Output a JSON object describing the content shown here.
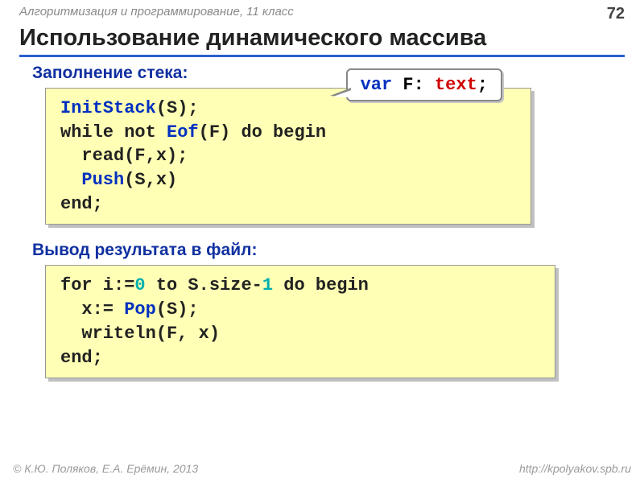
{
  "header": {
    "course": "Алгоритмизация и программирование, 11 класс",
    "page": "72"
  },
  "title": "Использование динамического массива",
  "section1_title": "Заполнение стека:",
  "callout": {
    "kw_var": "var",
    "var_name": " F",
    "colon": ": ",
    "type": "text",
    "semi": ";"
  },
  "code1": {
    "l1_fn": "InitStack",
    "l1_rest": "(S);",
    "l2_a": "while not ",
    "l2_fn": "Eof",
    "l2_b": "(F) do begin",
    "l3": "  read(F,x);",
    "l4_sp": "  ",
    "l4_fn": "Push",
    "l4_b": "(S,x)",
    "l5": "end;"
  },
  "section2_title": "Вывод результата в файл:",
  "code2": {
    "l1_a": "for i:=",
    "l1_zero": "0",
    "l1_b": " to S.size-",
    "l1_one": "1",
    "l1_c": " do begin",
    "l2_a": "  x:= ",
    "l2_fn": "Pop",
    "l2_b": "(S);",
    "l3": "  writeln(F, x)",
    "l4": "end;"
  },
  "footer": {
    "left": "© К.Ю. Поляков, Е.А. Ерёмин, 2013",
    "right": "http://kpolyakov.spb.ru"
  }
}
